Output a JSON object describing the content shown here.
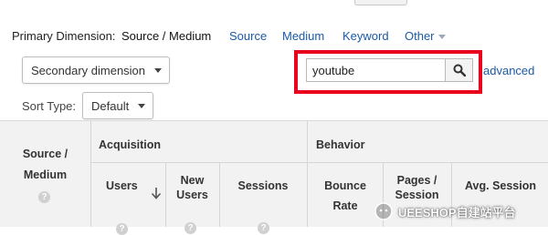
{
  "primary_dimension": {
    "label": "Primary Dimension:",
    "active": "Source / Medium",
    "links": [
      "Source",
      "Medium",
      "Keyword",
      "Other"
    ]
  },
  "secondary_dimension": {
    "label": "Secondary dimension"
  },
  "sort_type": {
    "label": "Sort Type:",
    "value": "Default"
  },
  "search": {
    "value": "youtube",
    "advanced_label": "advanced",
    "highlight_color": "#e8001c"
  },
  "table": {
    "dimension_header": [
      "Source /",
      "Medium"
    ],
    "group_acquisition": "Acquisition",
    "group_behavior": "Behavior",
    "columns": {
      "users": "Users",
      "new_users": [
        "New",
        "Users"
      ],
      "sessions": "Sessions",
      "bounce_rate": [
        "Bounce",
        "Rate"
      ],
      "pages_session": [
        "Pages /",
        "Session"
      ],
      "avg_session": "Avg. Session"
    },
    "help_glyph": "?"
  },
  "watermark": {
    "text": "UEESHOP自建站平台"
  },
  "colors": {
    "link": "#1a5aa8",
    "header_bg": "#f2f2f2"
  }
}
